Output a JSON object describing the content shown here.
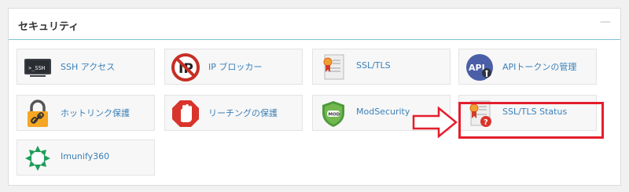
{
  "panel": {
    "title": "セキュリティ",
    "collapse_label": "—"
  },
  "tiles": [
    {
      "label": "SSH アクセス",
      "icon": "terminal-icon"
    },
    {
      "label": "IP ブロッカー",
      "icon": "ip-blocker-icon"
    },
    {
      "label": "SSL/TLS",
      "icon": "certificate-icon"
    },
    {
      "label": "APIトークンの管理",
      "icon": "api-token-icon"
    },
    {
      "label": "ホットリンク保護",
      "icon": "lock-link-icon"
    },
    {
      "label": "リーチングの保護",
      "icon": "stop-hand-icon"
    },
    {
      "label": "ModSecurity",
      "icon": "mod-shield-icon"
    },
    {
      "label": "SSL/TLS Status",
      "icon": "certificate-status-icon"
    },
    {
      "label": "Imunify360",
      "icon": "imunify-icon"
    }
  ],
  "colors": {
    "link": "#3a80b9",
    "highlight": "#e41e2d",
    "header_border": "#7fc4d6"
  }
}
